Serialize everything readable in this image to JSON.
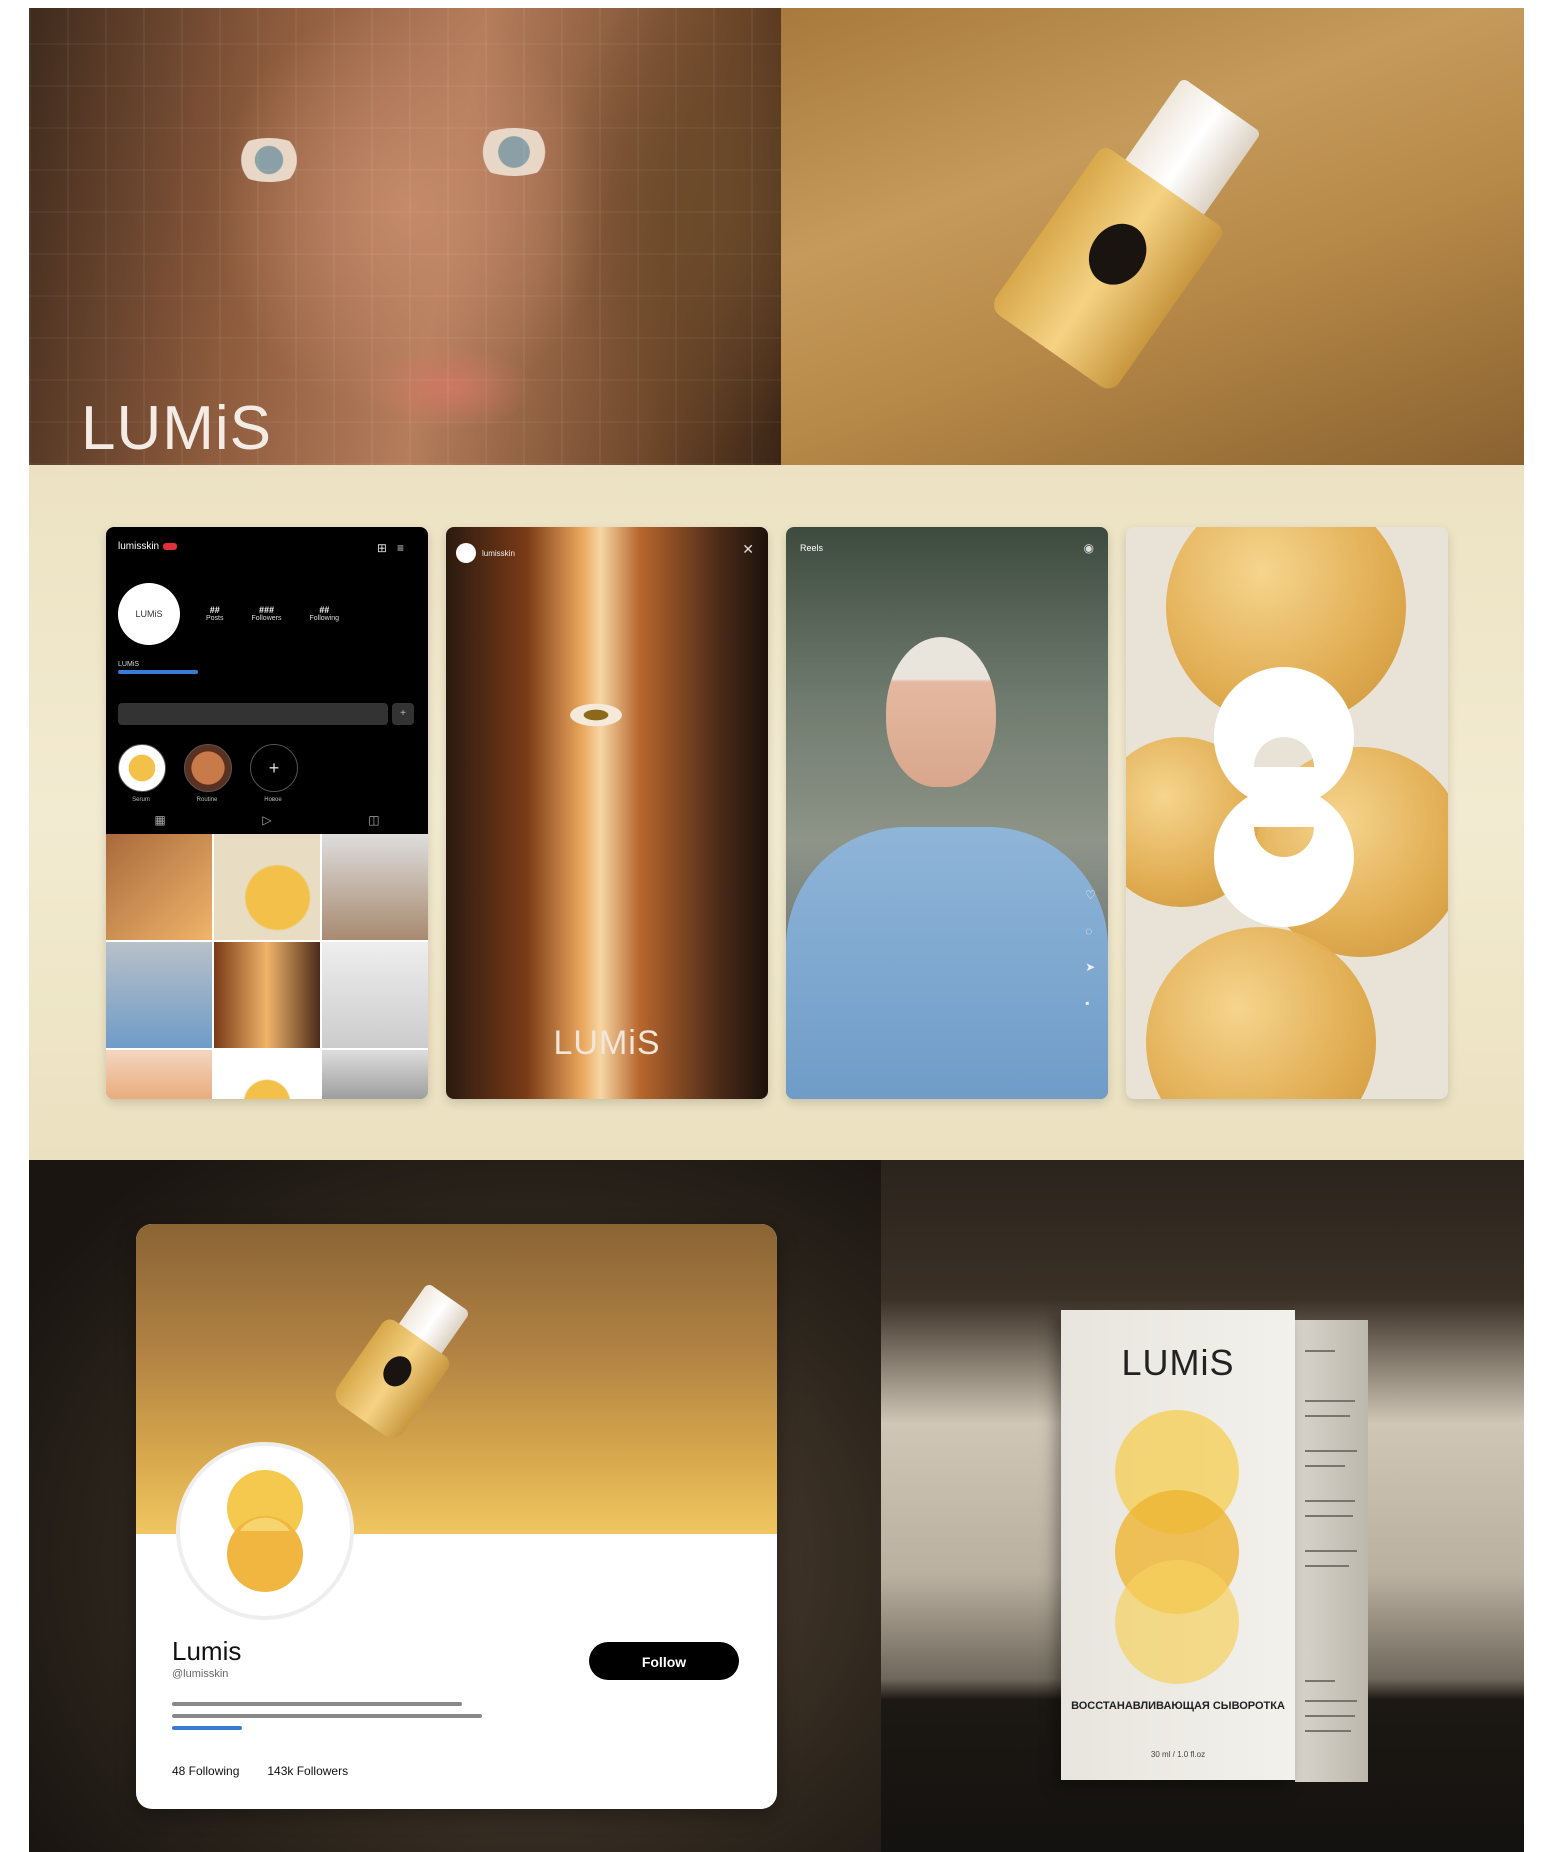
{
  "brand": {
    "wordmark": "LUMiS"
  },
  "instagram_profile": {
    "username": "lumisskin",
    "avatar_text": "LUMiS",
    "stats": [
      {
        "value": "##",
        "label": "Posts"
      },
      {
        "value": "###",
        "label": "Followers"
      },
      {
        "value": "##",
        "label": "Following"
      }
    ],
    "display_name": "LUMiS",
    "highlights": [
      "Serum",
      "Routine",
      "Новое"
    ]
  },
  "story": {
    "username": "lumisskin",
    "wordmark": "LUMiS"
  },
  "reel": {
    "title": "Reels"
  },
  "social_profile": {
    "name": "Lumis",
    "handle": "@lumisskin",
    "follow_label": "Follow",
    "following": "48 Following",
    "followers": "143k Followers"
  },
  "package": {
    "wordmark": "LUMiS",
    "product_name": "ВОССТАНАВЛИВАЮЩАЯ СЫВОРОТКА",
    "size": "30 ml / 1.0 fl.oz"
  },
  "colors": {
    "brand_yellow": "#f0c45a",
    "accent_black": "#000000",
    "link_blue": "#3a7bd5"
  }
}
